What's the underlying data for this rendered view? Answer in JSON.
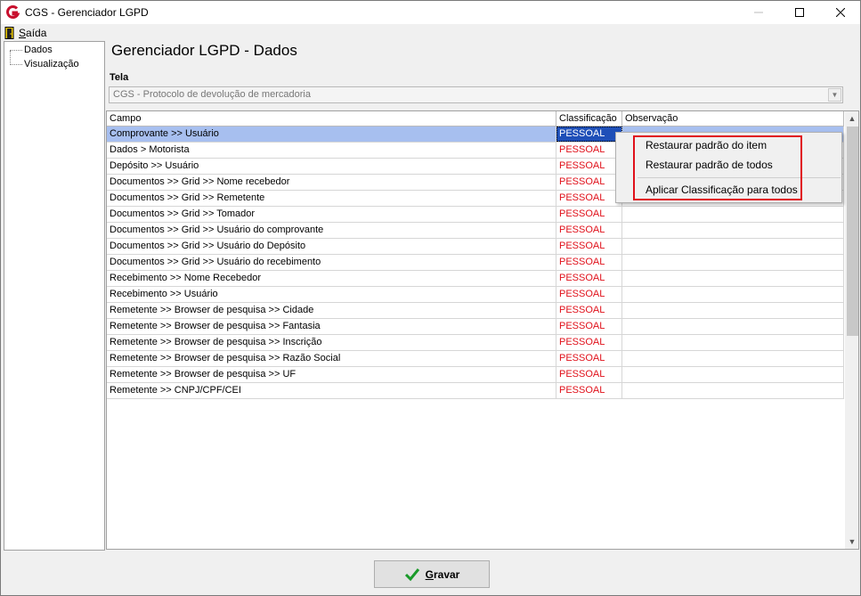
{
  "window": {
    "title": "CGS - Gerenciador LGPD"
  },
  "menu": {
    "exit_label": "Saída",
    "exit_mnemonic": "S",
    "exit_rest": "aída"
  },
  "tree": {
    "items": [
      {
        "label": "Dados"
      },
      {
        "label": "Visualização"
      }
    ]
  },
  "main": {
    "page_title": "Gerenciador LGPD - Dados",
    "tela_label": "Tela",
    "tela_value": "CGS - Protocolo de devolução de mercadoria"
  },
  "grid": {
    "headers": [
      "Campo",
      "Classificação",
      "Observação"
    ],
    "rows": [
      {
        "campo": "Comprovante >> Usuário",
        "classificacao": "PESSOAL",
        "observacao": ""
      },
      {
        "campo": "Dados > Motorista",
        "classificacao": "PESSOAL",
        "observacao": ""
      },
      {
        "campo": "Depósito >> Usuário",
        "classificacao": "PESSOAL",
        "observacao": ""
      },
      {
        "campo": "Documentos >> Grid >> Nome recebedor",
        "classificacao": "PESSOAL",
        "observacao": ""
      },
      {
        "campo": "Documentos >> Grid >> Remetente",
        "classificacao": "PESSOAL",
        "observacao": ""
      },
      {
        "campo": "Documentos >> Grid >> Tomador",
        "classificacao": "PESSOAL",
        "observacao": ""
      },
      {
        "campo": "Documentos >> Grid >> Usuário do comprovante",
        "classificacao": "PESSOAL",
        "observacao": ""
      },
      {
        "campo": "Documentos >> Grid >> Usuário do Depósito",
        "classificacao": "PESSOAL",
        "observacao": ""
      },
      {
        "campo": "Documentos >> Grid >> Usuário do recebimento",
        "classificacao": "PESSOAL",
        "observacao": ""
      },
      {
        "campo": "Recebimento >> Nome Recebedor",
        "classificacao": "PESSOAL",
        "observacao": ""
      },
      {
        "campo": "Recebimento >> Usuário",
        "classificacao": "PESSOAL",
        "observacao": ""
      },
      {
        "campo": "Remetente >> Browser de pesquisa >> Cidade",
        "classificacao": "PESSOAL",
        "observacao": ""
      },
      {
        "campo": "Remetente >> Browser de pesquisa >> Fantasia",
        "classificacao": "PESSOAL",
        "observacao": ""
      },
      {
        "campo": "Remetente >> Browser de pesquisa >> Inscrição",
        "classificacao": "PESSOAL",
        "observacao": ""
      },
      {
        "campo": "Remetente >> Browser de pesquisa >> Razão Social",
        "classificacao": "PESSOAL",
        "observacao": ""
      },
      {
        "campo": "Remetente >> Browser de pesquisa >> UF",
        "classificacao": "PESSOAL",
        "observacao": ""
      },
      {
        "campo": "Remetente >> CNPJ/CPF/CEI",
        "classificacao": "PESSOAL",
        "observacao": ""
      }
    ]
  },
  "context_menu": {
    "items": [
      "Restaurar padrão do item",
      "Restaurar padrão de todos",
      "Aplicar Classificação para todos"
    ]
  },
  "footer": {
    "save_label": "Gravar",
    "save_mnemonic": "G",
    "save_rest": "ravar"
  },
  "colors": {
    "classification_red": "#e0101a",
    "selection_blue": "#1e4fb8",
    "highlight_red": "#e0101a"
  }
}
